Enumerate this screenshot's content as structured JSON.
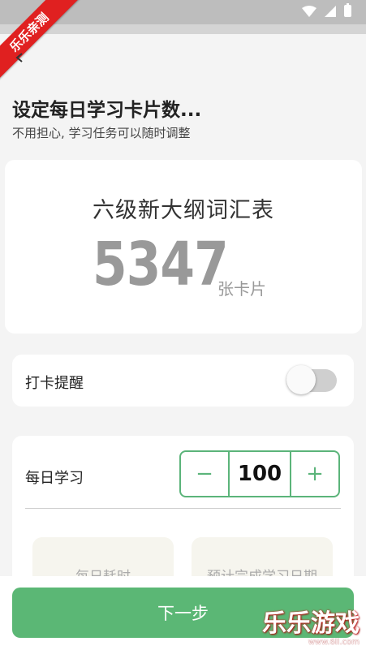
{
  "watermark_badge": "乐乐亲测",
  "header": {
    "title": "设定每日学习卡片数...",
    "subtitle": "不用担心, 学习任务可以随时调整"
  },
  "vocab_card": {
    "name": "六级新大纲词汇表",
    "count": "5347",
    "unit": "张卡片"
  },
  "reminder": {
    "label": "打卡提醒",
    "enabled": false
  },
  "daily": {
    "label": "每日学习",
    "minus": "−",
    "value": "100",
    "plus": "+",
    "stat_time_label": "每日耗时",
    "stat_date_label": "预计完成学习日期"
  },
  "footer": {
    "next_label": "下一步"
  },
  "watermark": {
    "brand": "乐乐游戏",
    "url": "www.6ll.com"
  },
  "colors": {
    "accent": "#5bb775",
    "ribbon": "#e02020"
  },
  "icons": [
    "wifi-icon",
    "signal-icon",
    "battery-icon",
    "back-arrow-icon"
  ]
}
